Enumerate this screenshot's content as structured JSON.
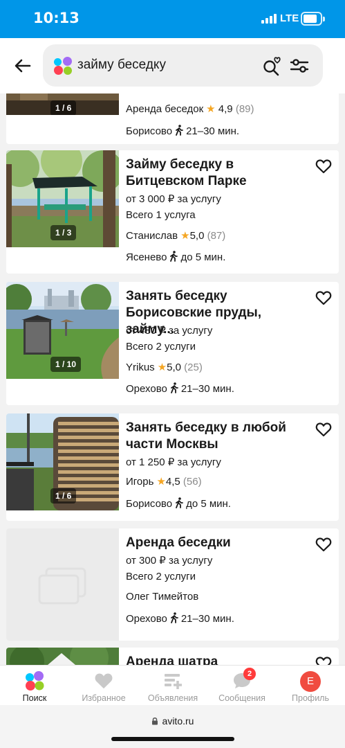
{
  "status_bar": {
    "time": "10:13",
    "network": "LTE"
  },
  "search": {
    "query": "займу беседку"
  },
  "listings": [
    {
      "photo_counter": "1 / 6",
      "title": "",
      "subtitle": "Аренда беседок",
      "rating": "4,9",
      "reviews": "(89)",
      "location": "Борисово",
      "travel_time": "21–30 мин."
    },
    {
      "photo_counter": "1 / 3",
      "title": "Займу беседку в Битцевском Парке",
      "price": "от 3 000 ₽ за услугу",
      "services": "Всего 1 услуга",
      "seller": "Станислав",
      "rating": "5,0",
      "reviews": "(87)",
      "location": "Ясенево",
      "travel_time": "до 5 мин."
    },
    {
      "photo_counter": "1 / 10",
      "title": "Занять беседку Борисовские пруды, займу...",
      "price": "от 480 ₽ за услугу",
      "services": "Всего 2 услуги",
      "seller": "Yrikus",
      "rating": "5,0",
      "reviews": "(25)",
      "location": "Орехово",
      "travel_time": "21–30 мин."
    },
    {
      "photo_counter": "1 / 6",
      "title": "Занять беседку в любой части Москвы",
      "price": "от 1 250 ₽ за услугу",
      "seller": "Игорь",
      "rating": "4,5",
      "reviews": "(56)",
      "location": "Борисово",
      "travel_time": "до 5 мин."
    },
    {
      "title": "Аренда беседки",
      "price": "от 300 ₽ за услугу",
      "services": "Всего 2 услуги",
      "seller": "Олег Тимейтов",
      "location": "Орехово",
      "travel_time": "21–30 мин."
    },
    {
      "title": "Аренда шатра"
    }
  ],
  "tabs": [
    {
      "label": "Поиск",
      "icon": "avito-logo-icon",
      "active": true
    },
    {
      "label": "Избранное",
      "icon": "heart-icon"
    },
    {
      "label": "Объявления",
      "icon": "post-ad-icon"
    },
    {
      "label": "Сообщения",
      "icon": "chat-icon",
      "badge": "2"
    },
    {
      "label": "Профиль",
      "icon": "avatar",
      "avatar_letter": "E"
    }
  ],
  "browser": {
    "url": "avito.ru"
  },
  "colors": {
    "status_bar": "#0096e8",
    "star": "#f5a623",
    "badge": "#ff3b3b",
    "avatar": "#f04c40"
  }
}
